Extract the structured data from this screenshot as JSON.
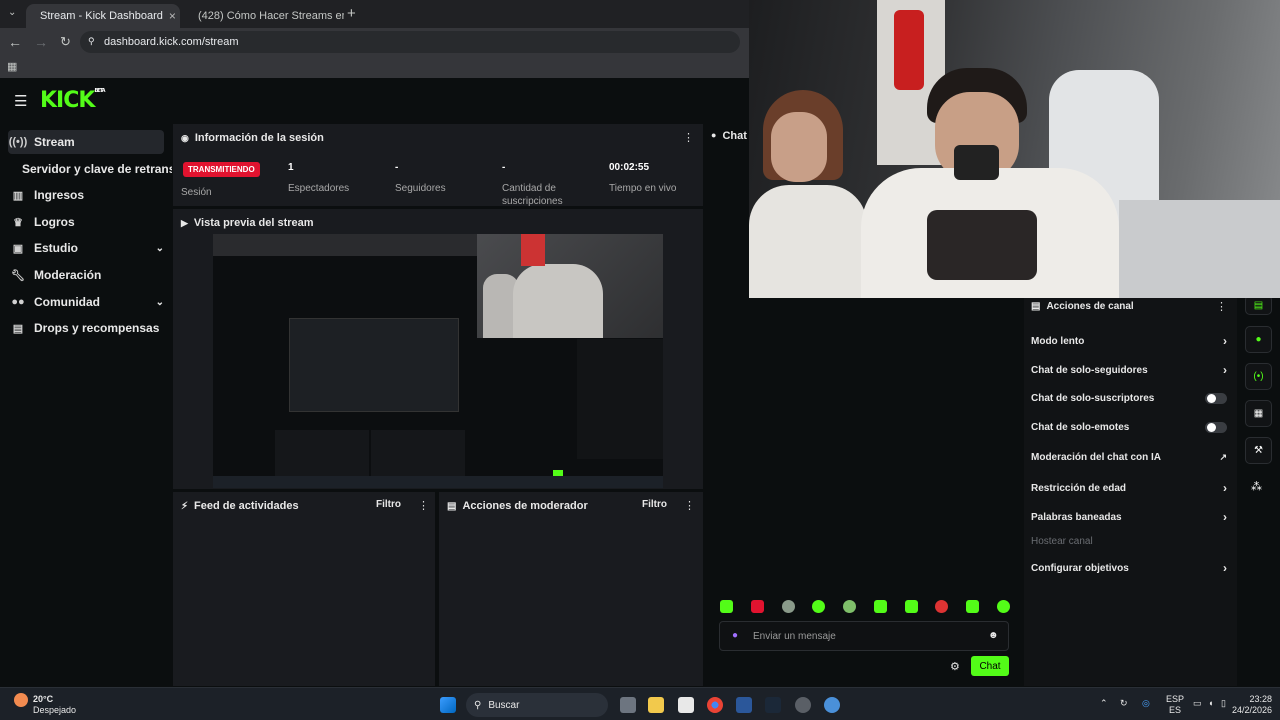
{
  "browser": {
    "tabs": [
      {
        "title": "Stream - Kick Dashboard",
        "active": true
      },
      {
        "title": "(428) Cómo Hacer Streams en",
        "active": false
      }
    ],
    "url": "dashboard.kick.com/stream"
  },
  "kick": {
    "logo": "KICK",
    "logo_badge": "BETA",
    "sidebar": [
      {
        "label": "Stream",
        "icon": "broadcast-icon",
        "active": true
      },
      {
        "label": "Servidor y clave de retransm"
      },
      {
        "label": "Ingresos",
        "icon": "chart-icon"
      },
      {
        "label": "Logros",
        "icon": "trophy-icon"
      },
      {
        "label": "Estudio",
        "icon": "studio-icon",
        "expandable": true
      },
      {
        "label": "Moderación",
        "icon": "wrench-icon"
      },
      {
        "label": "Comunidad",
        "icon": "people-icon",
        "expandable": true
      },
      {
        "label": "Drops y recompensas",
        "icon": "gift-icon"
      }
    ],
    "session": {
      "title": "Información de la sesión",
      "status_badge": "TRANSMITIENDO",
      "session_label": "Sesión",
      "stats": [
        {
          "value": "1",
          "label": "Espectadores"
        },
        {
          "value": "-",
          "label": "Seguidores"
        },
        {
          "value": "-",
          "label": "Cantidad de suscripciones"
        },
        {
          "value": "00:02:55",
          "label": "Tiempo en vivo"
        }
      ]
    },
    "preview": {
      "title": "Vista previa del stream"
    },
    "feed": {
      "title": "Feed de actividades",
      "filter": "Filtro"
    },
    "modactions": {
      "title": "Acciones de moderador",
      "filter": "Filtro"
    },
    "chat": {
      "title": "Chat",
      "placeholder": "Enviar un mensaje",
      "send": "Chat"
    },
    "channel_actions": {
      "title": "Acciones de canal",
      "items": [
        {
          "label": "Modo lento",
          "control": "arrow"
        },
        {
          "label": "Chat de solo-seguidores",
          "control": "arrow"
        },
        {
          "label": "Chat de solo-suscriptores",
          "control": "toggle"
        },
        {
          "label": "Chat de solo-emotes",
          "control": "toggle"
        },
        {
          "label": "Moderación del chat con IA",
          "control": "external"
        },
        {
          "label": "Restricción de edad",
          "control": "arrow"
        },
        {
          "label": "Palabras baneadas",
          "control": "arrow"
        },
        {
          "label": "Hostear canal",
          "control": "disabled"
        },
        {
          "label": "Configurar objetivos",
          "control": "arrow"
        }
      ]
    }
  },
  "colors": {
    "accent": "#53fc18",
    "live": "#e1132f",
    "panel": "#191b1f"
  },
  "taskbar": {
    "weather_temp": "20°C",
    "weather_desc": "Despejado",
    "search": "Buscar",
    "lang": "ESP",
    "lang2": "ES",
    "time": "23:28",
    "date": "24/2/2026"
  }
}
